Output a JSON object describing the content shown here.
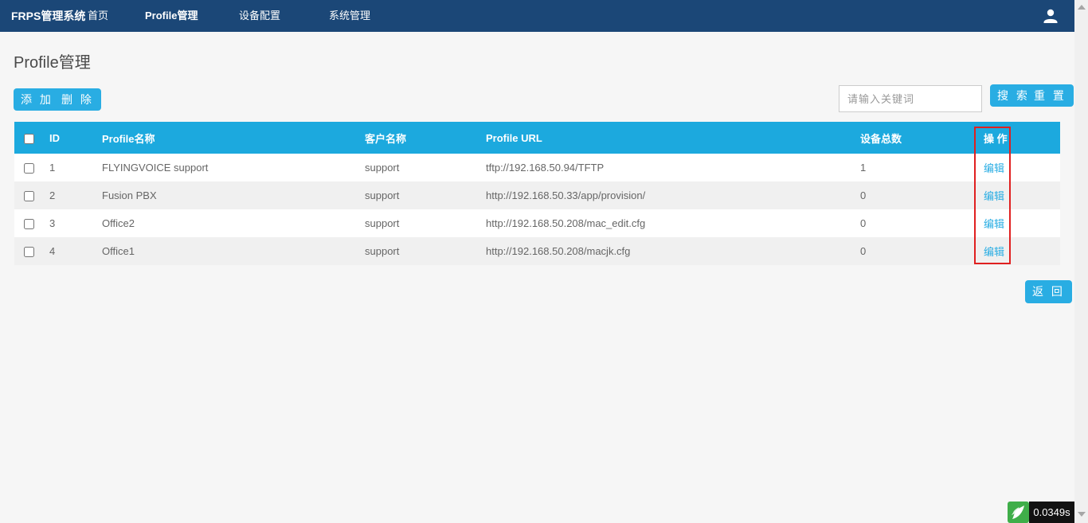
{
  "navbar": {
    "brand": "FRPS管理系统",
    "items": [
      {
        "label": "首页",
        "active": false
      },
      {
        "label": "Profile管理",
        "active": true
      },
      {
        "label": "设备配置",
        "active": false
      },
      {
        "label": "系统管理",
        "active": false
      }
    ],
    "user_icon": "user-icon"
  },
  "page": {
    "title": "Profile管理"
  },
  "toolbar": {
    "add_label": "添 加",
    "delete_label": "删 除",
    "search_placeholder": "请输入关键词",
    "search_input_value": "",
    "search_label": "搜 索",
    "reset_label": "重 置"
  },
  "table": {
    "headers": [
      "ID",
      "Profile名称",
      "客户名称",
      "Profile URL",
      "设备总数",
      "操 作"
    ],
    "rows": [
      {
        "id": "1",
        "profile_name": "FLYINGVOICE support",
        "customer": "support",
        "url": "tftp://192.168.50.94/TFTP",
        "device_count": "1",
        "action": "编辑"
      },
      {
        "id": "2",
        "profile_name": "Fusion PBX",
        "customer": "support",
        "url": "http://192.168.50.33/app/provision/",
        "device_count": "0",
        "action": "编辑"
      },
      {
        "id": "3",
        "profile_name": "Office2",
        "customer": "support",
        "url": "http://192.168.50.208/mac_edit.cfg",
        "device_count": "0",
        "action": "编辑"
      },
      {
        "id": "4",
        "profile_name": "Office1",
        "customer": "support",
        "url": "http://192.168.50.208/macjk.cfg",
        "device_count": "0",
        "action": "编辑"
      }
    ],
    "back_label": "返 回"
  },
  "annotation": {
    "shape": "red-rectangle",
    "color": "#e02020",
    "marks": "操作 column with 编辑 links"
  },
  "footer": {
    "elapsed_time": "0.0349s",
    "icon": "thinkphp-logo-icon"
  },
  "colors": {
    "navbar_bg": "#1b4777",
    "table_header_bg": "#1ca9de",
    "button_blue": "#29ade3",
    "annotation_red": "#e02020",
    "badge_bg": "#121212",
    "logo_green": "#3fae49",
    "page_bg": "#f6f6f6",
    "row_stripe": "#f0f0f0"
  }
}
